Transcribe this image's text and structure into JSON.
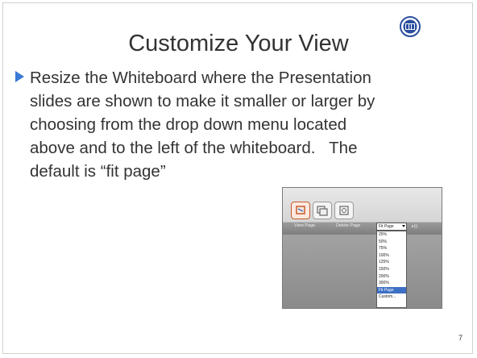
{
  "slide": {
    "title": "Customize Your View",
    "body_lines": [
      "Resize the Whiteboard where the Presentation",
      "slides are shown to make it smaller or larger by",
      "choosing from the drop down menu located",
      "above and to the left of the whiteboard.   The",
      "default is “fit page”"
    ],
    "page_number": "7"
  },
  "screenshot": {
    "tabs": [
      "View Page",
      "Delete Page"
    ],
    "select_value": "Fit Page",
    "side_label": "▸|||",
    "menu_options": [
      "25%",
      "50%",
      "75%",
      "100%",
      "125%",
      "150%",
      "200%",
      "300%",
      "Fit Page",
      "Custom..."
    ],
    "selected_option": "Fit Page"
  },
  "colors": {
    "bullet": "#3a7bd5",
    "text": "#333333",
    "logo": "#2a4f9e"
  }
}
